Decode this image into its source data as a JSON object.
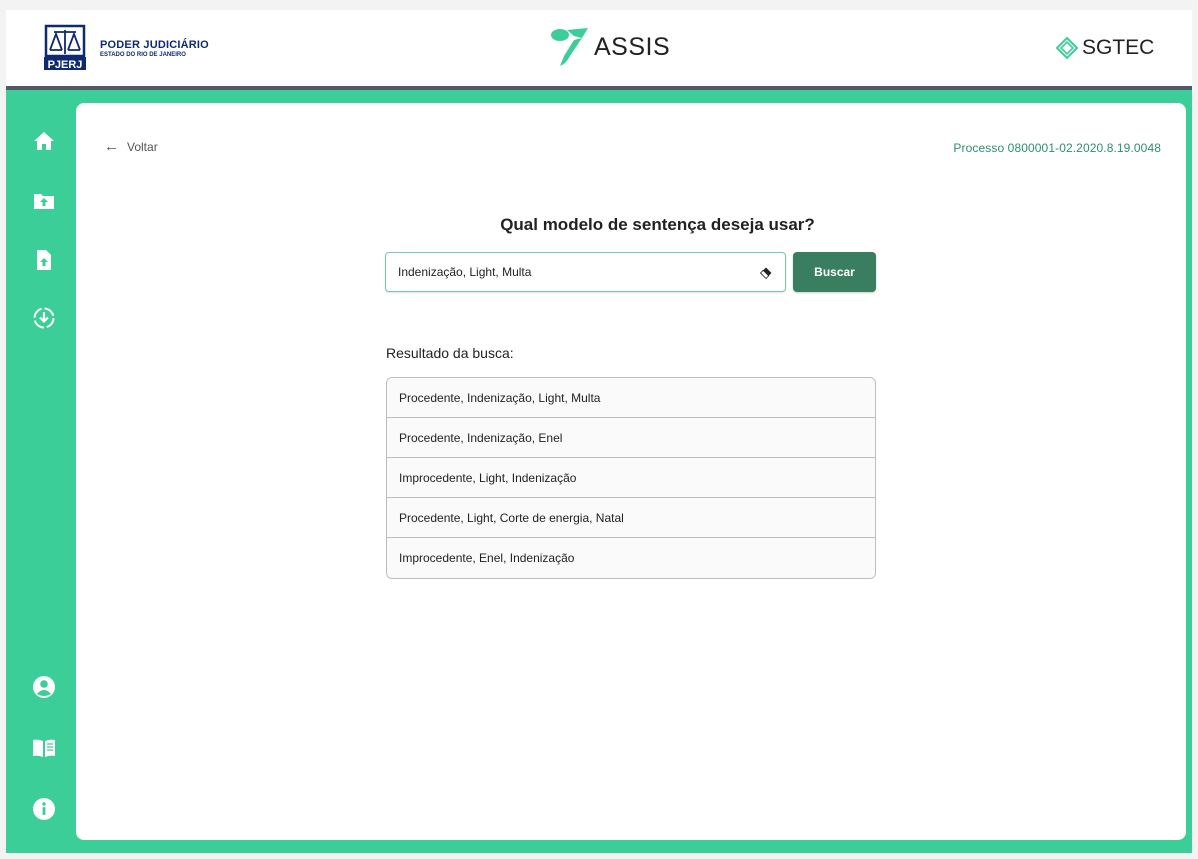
{
  "header": {
    "org_title": "PODER JUDICIÁRIO",
    "org_subtitle": "ESTADO DO RIO DE JANEIRO",
    "pjerj_logo_text": "PJERJ",
    "app_name": "ASSIS",
    "partner_name": "SGTEC"
  },
  "sidebar": {
    "top_items": [
      {
        "icon": "home-icon"
      },
      {
        "icon": "folder-upload-icon"
      },
      {
        "icon": "file-upload-icon"
      },
      {
        "icon": "download-circle-icon"
      }
    ],
    "bottom_items": [
      {
        "icon": "user-icon"
      },
      {
        "icon": "book-icon"
      },
      {
        "icon": "info-icon"
      }
    ]
  },
  "main": {
    "back_label": "Voltar",
    "process_label": "Processo 0800001-02.2020.8.19.0048",
    "question": "Qual modelo de sentença deseja usar?",
    "search": {
      "value": "Indenização, Light, Multa",
      "button_label": "Buscar"
    },
    "results_label": "Resultado da busca:",
    "results": [
      "Procedente, Indenização, Light, Multa",
      "Procedente, Indenização, Enel",
      "Improcedente, Light, Indenização",
      "Procedente, Light, Corte de energia, Natal",
      "Improcedente, Enel, Indenização"
    ]
  },
  "colors": {
    "accent_green": "#3cce98",
    "button_green": "#3a7e60",
    "process_text": "#2f8f6a",
    "brand_blue": "#0f2a6e",
    "header_rule": "#4f5a66"
  }
}
